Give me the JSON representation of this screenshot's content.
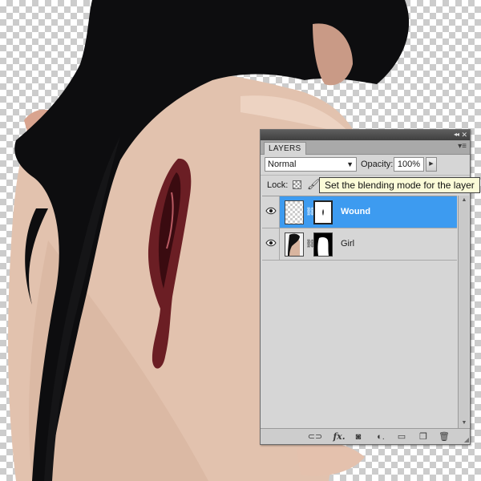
{
  "panel": {
    "tab_label": "LAYERS",
    "collapse_glyph": "◂◂",
    "close_glyph": "✕",
    "menu_glyph": "▾≡"
  },
  "blend": {
    "mode_value": "Normal",
    "arrow_glyph": "▼"
  },
  "opacity": {
    "label": "Opacity:",
    "value": "100%",
    "button_glyph": "▶"
  },
  "lock": {
    "label": "Lock:",
    "brush_glyph": "🖌"
  },
  "tooltip": {
    "text": "Set the blending mode for the layer"
  },
  "layers": [
    {
      "name": "Wound",
      "selected": true,
      "visible": true
    },
    {
      "name": "Girl",
      "selected": false,
      "visible": true
    }
  ],
  "glyphs": {
    "chain": "⛓",
    "scroll_up": "▲",
    "scroll_down": "▼",
    "link": "⊂⊃",
    "fx": "fx.",
    "mask": "◙",
    "adjust": "◐.",
    "group": "▭",
    "new_layer": "❐",
    "trash": "🗑",
    "grip": "◢"
  },
  "colors": {
    "selection": "#3d9bf0",
    "panel_bg": "#d6d6d6",
    "tooltip_bg": "#fbfbd8"
  }
}
